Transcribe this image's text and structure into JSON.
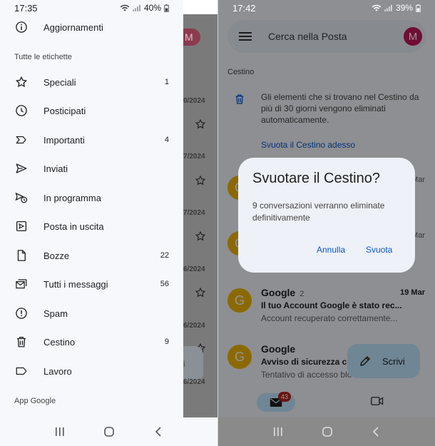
{
  "left": {
    "status": {
      "time": "17:35",
      "battery": "40%"
    },
    "drawer": {
      "top_item": "Aggiornamenti",
      "section_labels": "Tutte le etichette",
      "items": [
        {
          "label": "Speciali",
          "count": "1",
          "icon": "star-icon"
        },
        {
          "label": "Posticipati",
          "count": "",
          "icon": "clock-icon"
        },
        {
          "label": "Importanti",
          "count": "4",
          "icon": "important-icon"
        },
        {
          "label": "Inviati",
          "count": "",
          "icon": "send-icon"
        },
        {
          "label": "In programma",
          "count": "",
          "icon": "scheduled-icon"
        },
        {
          "label": "Posta in uscita",
          "count": "",
          "icon": "outbox-icon"
        },
        {
          "label": "Bozze",
          "count": "22",
          "icon": "draft-icon"
        },
        {
          "label": "Tutti i messaggi",
          "count": "56",
          "icon": "all-mail-icon"
        },
        {
          "label": "Spam",
          "count": "",
          "icon": "spam-icon"
        },
        {
          "label": "Cestino",
          "count": "9",
          "icon": "trash-icon"
        },
        {
          "label": "Lavoro",
          "count": "",
          "icon": "label-icon"
        }
      ],
      "apps_label": "App Google"
    },
    "behind": {
      "avatar": "M",
      "dates": [
        "0/2024",
        "7/2024",
        "7/2024",
        "6/2024",
        "6/2024",
        "6/2024"
      ],
      "fab_char": "i"
    }
  },
  "right": {
    "status": {
      "time": "17:42",
      "battery": "39%"
    },
    "search": {
      "placeholder": "Cerca nella Posta",
      "avatar": "M"
    },
    "folder": "Cestino",
    "trash_info": "Gli elementi che si trovano nel Cestino da più di 30 giorni vengono eliminati automaticamente.",
    "empty_now": "Svuota il Cestino adesso",
    "dialog": {
      "title": "Svuotare il Cestino?",
      "message": "9 conversazioni verranno eliminate definitivamente",
      "cancel": "Annulla",
      "confirm": "Svuota"
    },
    "peek_dates": [
      "Mar",
      "Mar"
    ],
    "mails": [
      {
        "avatar": "G",
        "sender": "Google",
        "count": "2",
        "date": "19 Mar",
        "subject": "Il tuo Account Google è stato rec...",
        "preview": "Account recuperato correttamente..."
      },
      {
        "avatar": "G",
        "sender": "Google",
        "count": "",
        "date": "",
        "subject": "Avviso di sicurezza c",
        "preview": "Tentativo di accesso blo"
      }
    ],
    "fab": "Scrivi",
    "badge": "43"
  }
}
